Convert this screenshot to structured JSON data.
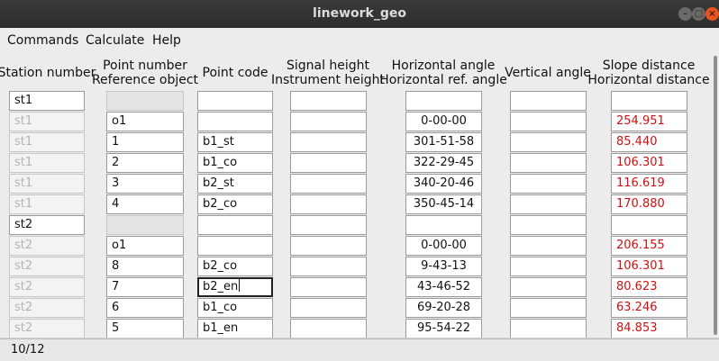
{
  "window": {
    "title": "linework_geo"
  },
  "menu": [
    "Commands",
    "Calculate",
    "Help"
  ],
  "headers": {
    "station": [
      "Station number"
    ],
    "point": [
      "Point number",
      "Reference object"
    ],
    "code": [
      "Point code"
    ],
    "signal": [
      "Signal height",
      "Instrument height"
    ],
    "hangle": [
      "Horizontal angle",
      "Horizontal ref. angle"
    ],
    "vangle": [
      "Vertical angle"
    ],
    "dist": [
      "Slope distance",
      "Horizontal distance"
    ]
  },
  "rows": [
    {
      "station": "st1",
      "point": "",
      "code": "",
      "signal": "",
      "hangle": "",
      "vangle": "",
      "dist": "",
      "station_row": true
    },
    {
      "station": "st1",
      "point": "o1",
      "code": "",
      "signal": "",
      "hangle": "0-00-00",
      "vangle": "",
      "dist": "254.951"
    },
    {
      "station": "st1",
      "point": "1",
      "code": "b1_st",
      "signal": "",
      "hangle": "301-51-58",
      "vangle": "",
      "dist": "85.440"
    },
    {
      "station": "st1",
      "point": "2",
      "code": "b1_co",
      "signal": "",
      "hangle": "322-29-45",
      "vangle": "",
      "dist": "106.301"
    },
    {
      "station": "st1",
      "point": "3",
      "code": "b2_st",
      "signal": "",
      "hangle": "340-20-46",
      "vangle": "",
      "dist": "116.619"
    },
    {
      "station": "st1",
      "point": "4",
      "code": "b2_co",
      "signal": "",
      "hangle": "350-45-14",
      "vangle": "",
      "dist": "170.880"
    },
    {
      "station": "st2",
      "point": "",
      "code": "",
      "signal": "",
      "hangle": "",
      "vangle": "",
      "dist": "",
      "station_row": true
    },
    {
      "station": "st2",
      "point": "o1",
      "code": "",
      "signal": "",
      "hangle": "0-00-00",
      "vangle": "",
      "dist": "206.155"
    },
    {
      "station": "st2",
      "point": "8",
      "code": "b2_co",
      "signal": "",
      "hangle": "9-43-13",
      "vangle": "",
      "dist": "106.301"
    },
    {
      "station": "st2",
      "point": "7",
      "code": "b2_en",
      "signal": "",
      "hangle": "43-46-52",
      "vangle": "",
      "dist": "80.623",
      "focused": true
    },
    {
      "station": "st2",
      "point": "6",
      "code": "b1_co",
      "signal": "",
      "hangle": "69-20-28",
      "vangle": "",
      "dist": "63.246"
    },
    {
      "station": "st2",
      "point": "5",
      "code": "b1_en",
      "signal": "",
      "hangle": "95-54-22",
      "vangle": "",
      "dist": "84.853"
    }
  ],
  "status": {
    "text": "10/12"
  },
  "colors": {
    "distance_text": "#d01010",
    "close_button": "#e95420"
  }
}
